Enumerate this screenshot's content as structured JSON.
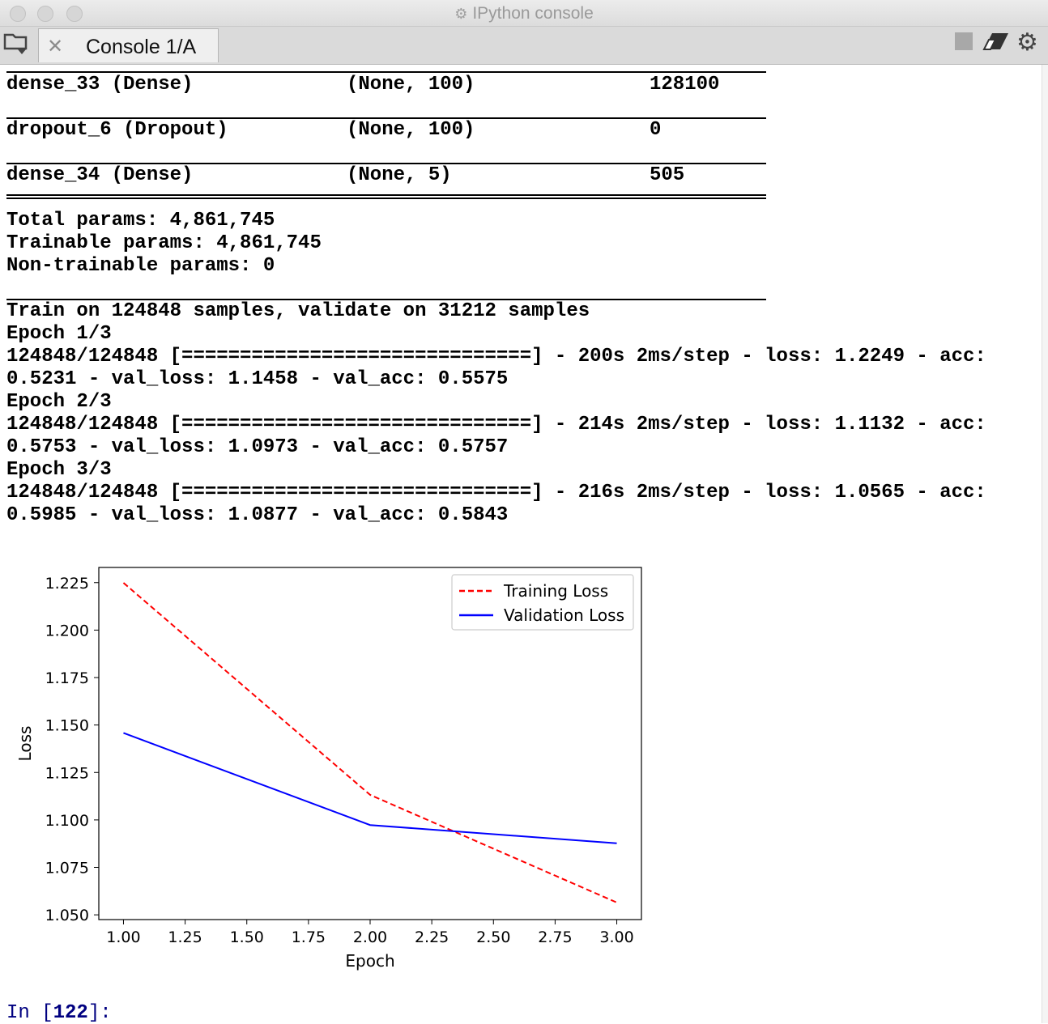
{
  "window": {
    "title": "IPython console"
  },
  "tab": {
    "label": "Console 1/A"
  },
  "icons": [
    "traffic-close",
    "traffic-minimize",
    "traffic-zoom",
    "browse-tabs-icon",
    "close-icon",
    "stop-icon",
    "eraser-icon",
    "gear-icon"
  ],
  "console": {
    "layers": [
      {
        "name": "dense_33 (Dense)",
        "shape": "(None, 100)",
        "params": "128100"
      },
      {
        "name": "dropout_6 (Dropout)",
        "shape": "(None, 100)",
        "params": "0"
      },
      {
        "name": "dense_34 (Dense)",
        "shape": "(None, 5)",
        "params": "505"
      }
    ],
    "totals": [
      "Total params: 4,861,745",
      "Trainable params: 4,861,745",
      "Non-trainable params: 0"
    ],
    "training": [
      "Train on 124848 samples, validate on 31212 samples",
      "Epoch 1/3",
      "124848/124848 [==============================] - 200s 2ms/step - loss: 1.2249 - acc:",
      "0.5231 - val_loss: 1.1458 - val_acc: 0.5575",
      "Epoch 2/3",
      "124848/124848 [==============================] - 214s 2ms/step - loss: 1.1132 - acc:",
      "0.5753 - val_loss: 1.0973 - val_acc: 0.5757",
      "Epoch 3/3",
      "124848/124848 [==============================] - 216s 2ms/step - loss: 1.0565 - acc:",
      "0.5985 - val_loss: 1.0877 - val_acc: 0.5843"
    ],
    "prompt_prefix": "In [",
    "prompt_number": "122",
    "prompt_suffix": "]:"
  },
  "chart_data": {
    "type": "line",
    "xlabel": "Epoch",
    "ylabel": "Loss",
    "xlim": [
      0.9,
      3.1
    ],
    "ylim": [
      1.0475,
      1.233
    ],
    "xticks": [
      "1.00",
      "1.25",
      "1.50",
      "1.75",
      "2.00",
      "2.25",
      "2.50",
      "2.75",
      "3.00"
    ],
    "yticks": [
      "1.050",
      "1.075",
      "1.100",
      "1.125",
      "1.150",
      "1.175",
      "1.200",
      "1.225"
    ],
    "legend_position": "upper-right",
    "grid": false,
    "series": [
      {
        "name": "Training Loss",
        "color": "#ff0000",
        "style": "dashed",
        "x": [
          1,
          2,
          3
        ],
        "y": [
          1.2249,
          1.1132,
          1.0565
        ]
      },
      {
        "name": "Validation Loss",
        "color": "#0000ff",
        "style": "solid",
        "x": [
          1,
          2,
          3
        ],
        "y": [
          1.1458,
          1.0973,
          1.0877
        ]
      }
    ]
  }
}
